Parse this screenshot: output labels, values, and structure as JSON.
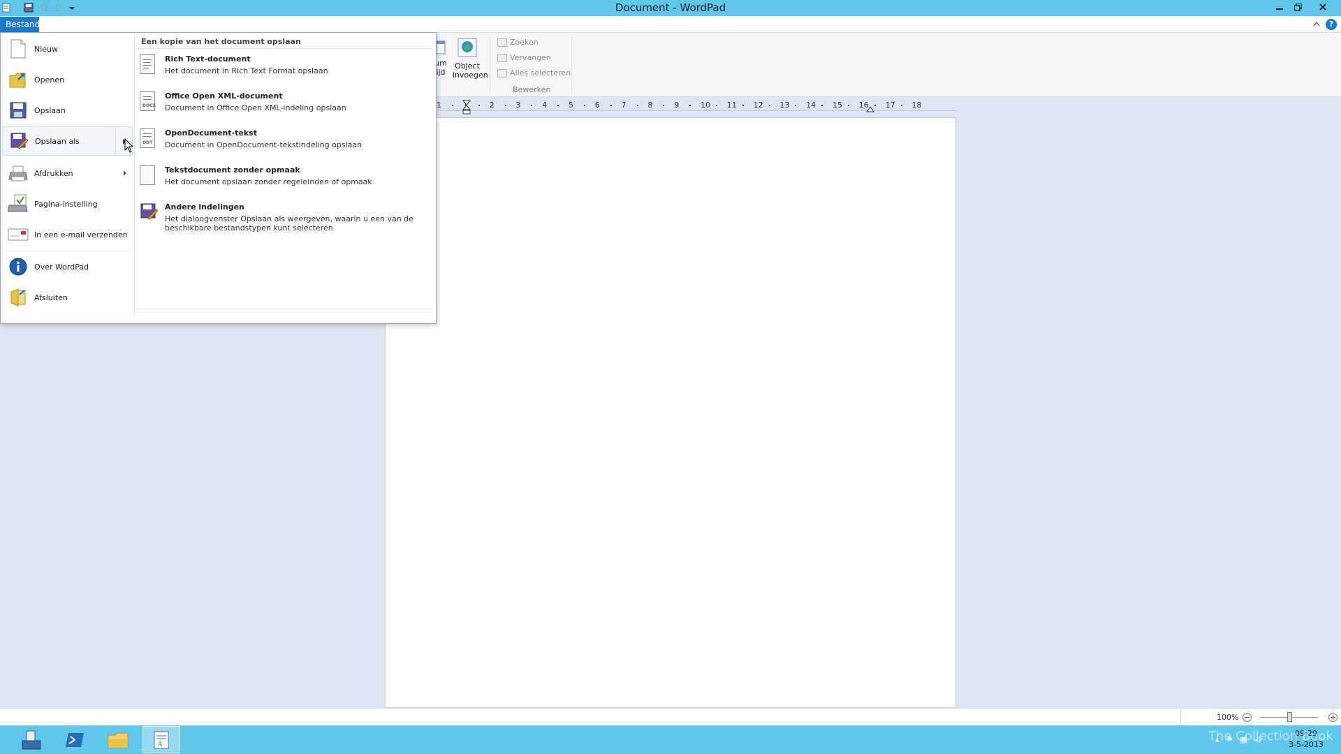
{
  "window": {
    "title": "Document - WordPad"
  },
  "tabs": {
    "file": "Bestand"
  },
  "ribbon": {
    "partial_button": "um\nijd",
    "insert_object": "Object\ninvoegen",
    "find": "Zoeken",
    "replace": "Vervangen",
    "select_all": "Alles selecteren",
    "edit_group": "Bewerken"
  },
  "ruler": {
    "ticks": [
      "1",
      "1",
      "2",
      "3",
      "4",
      "5",
      "6",
      "7",
      "8",
      "9",
      "10",
      "11",
      "12",
      "13",
      "14",
      "15",
      "16",
      "17",
      "18"
    ]
  },
  "file_menu": {
    "items": [
      {
        "label": "Nieuw",
        "icon": "new-document-icon"
      },
      {
        "label": "Openen",
        "icon": "open-folder-icon"
      },
      {
        "label": "Opslaan",
        "icon": "save-disk-icon"
      },
      {
        "label": "Opslaan als",
        "icon": "save-as-icon"
      },
      {
        "label": "Afdrukken",
        "icon": "printer-icon"
      },
      {
        "label": "Pagina-instelling",
        "icon": "page-setup-icon"
      },
      {
        "label": "In een e-mail verzenden",
        "icon": "email-icon"
      },
      {
        "label": "Over WordPad",
        "icon": "info-icon"
      },
      {
        "label": "Afsluiten",
        "icon": "exit-icon"
      }
    ],
    "submenu": {
      "title": "Een kopie van het document opslaan",
      "items": [
        {
          "title": "Rich Text-document",
          "desc": "Het document in Rich Text Format opslaan",
          "tag": ""
        },
        {
          "title": "Office Open XML-document",
          "desc": "Document in Office Open XML-indeling opslaan",
          "tag": "DOCX"
        },
        {
          "title": "OpenDocument-tekst",
          "desc": "Document in OpenDocument-tekstindeling opslaan",
          "tag": "ODT"
        },
        {
          "title": "Tekstdocument zonder opmaak",
          "desc": "Het document opslaan zonder regeleinden of opmaak",
          "tag": ""
        },
        {
          "title": "Andere indelingen",
          "desc": "Het dialoogvenster Opslaan als weergeven, waarin u een van de beschikbare bestandstypen kunt selecteren",
          "tag": ""
        }
      ]
    }
  },
  "status": {
    "zoom": "100%"
  },
  "taskbar": {
    "time": "09:29",
    "date": "3-5-2013",
    "watermark": "The Collection Book"
  },
  "colors": {
    "titlebar": "#5ec7ea",
    "file_tab": "#1979ca",
    "taskbar": "#5ec7ea"
  }
}
